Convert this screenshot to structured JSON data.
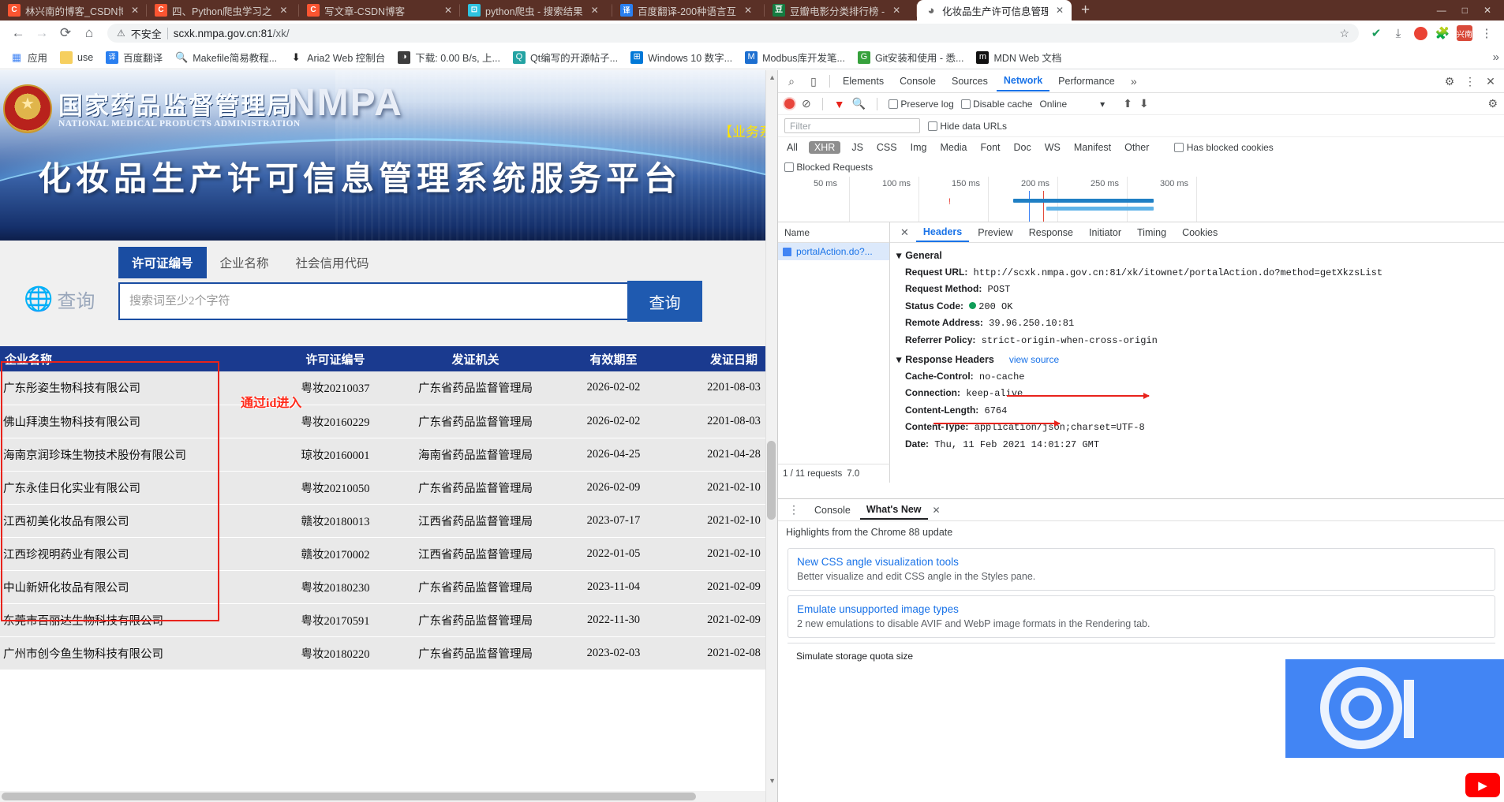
{
  "browser": {
    "tabs": [
      {
        "title": "林兴南的博客_CSDN博客",
        "icon": "csdn-icon",
        "active": false
      },
      {
        "title": "四、Python爬虫学习之",
        "icon": "csdn-icon",
        "active": false
      },
      {
        "title": "写文章-CSDN博客",
        "icon": "csdn-icon",
        "active": false
      },
      {
        "title": "python爬虫 - 搜索结果",
        "icon": "bot-icon",
        "active": false
      },
      {
        "title": "百度翻译-200种语言互",
        "icon": "translate-icon",
        "active": false
      },
      {
        "title": "豆瓣电影分类排行榜 - ",
        "icon": "douban-icon",
        "active": false
      },
      {
        "title": "化妆品生产许可信息管理",
        "icon": "globe-icon",
        "active": true
      }
    ],
    "new_tab_label": "+",
    "window_controls": [
      "—",
      "□",
      "✕"
    ],
    "omnibox": {
      "security_label": "不安全",
      "url_host": "scxk.nmpa.gov.cn:81",
      "url_path": "/xk/",
      "star_icon": "star-icon"
    },
    "toolbar_icons": [
      "back-icon",
      "forward-icon",
      "reload-icon",
      "home-icon",
      "avast-icon",
      "download-icon",
      "record-icon",
      "extensions-icon",
      "profile-icon",
      "menu-icon"
    ],
    "profile_label": "兴南",
    "bookmarks": [
      {
        "label": "应用",
        "icon": "apps-grid-icon"
      },
      {
        "label": "use",
        "icon": "folder-icon"
      },
      {
        "label": "百度翻译",
        "icon": "translate-icon"
      },
      {
        "label": "Makefile简易教程...",
        "icon": "search-page-icon"
      },
      {
        "label": "Aria2 Web 控制台",
        "icon": "download-arrow-icon"
      },
      {
        "label": "下载: 0.00 B/s, 上...",
        "icon": "speedometer-icon"
      },
      {
        "label": "Qt编写的开源帖子...",
        "icon": "qt-icon"
      },
      {
        "label": "Windows 10 数字...",
        "icon": "windows-icon"
      },
      {
        "label": "Modbus库开发笔...",
        "icon": "doc-icon"
      },
      {
        "label": "Git安装和使用 - 悉...",
        "icon": "git-icon"
      },
      {
        "label": "MDN Web 文档",
        "icon": "mdn-icon"
      }
    ],
    "bookmark_overflow": "»"
  },
  "site": {
    "org_cn": "国家药品监督管理局",
    "org_en": "NATIONAL MEDICAL PRODUCTS ADMINISTRATION",
    "brand": "NMPA",
    "system_title": "化妆品生产许可信息管理系统服务平台",
    "biz_link": "【业务系",
    "emblem_icon": "national-emblem-icon",
    "search": {
      "tabs": [
        {
          "label": "许可证编号",
          "active": true
        },
        {
          "label": "企业名称",
          "active": false
        },
        {
          "label": "社会信用代码",
          "active": false
        }
      ],
      "placeholder": "搜索词至少2个字符",
      "value": "",
      "button_label": "查询",
      "side_label": "查询",
      "globe_icon": "globe-search-icon"
    },
    "table": {
      "columns": [
        "企业名称",
        "许可证编号",
        "发证机关",
        "有效期至",
        "发证日期"
      ],
      "rows": [
        [
          "广东彤姿生物科技有限公司",
          "粤妆20210037",
          "广东省药品监督管理局",
          "2026-02-02",
          "2201-08-03"
        ],
        [
          "佛山拜澳生物科技有限公司",
          "粤妆20160229",
          "广东省药品监督管理局",
          "2026-02-02",
          "2201-08-03"
        ],
        [
          "海南京润珍珠生物技术股份有限公司",
          "琼妆20160001",
          "海南省药品监督管理局",
          "2026-04-25",
          "2021-04-28"
        ],
        [
          "广东永佳日化实业有限公司",
          "粤妆20210050",
          "广东省药品监督管理局",
          "2026-02-09",
          "2021-02-10"
        ],
        [
          "江西初美化妆品有限公司",
          "赣妆20180013",
          "江西省药品监督管理局",
          "2023-07-17",
          "2021-02-10"
        ],
        [
          "江西珍视明药业有限公司",
          "赣妆20170002",
          "江西省药品监督管理局",
          "2022-01-05",
          "2021-02-10"
        ],
        [
          "中山新妍化妆品有限公司",
          "粤妆20180230",
          "广东省药品监督管理局",
          "2023-11-04",
          "2021-02-09"
        ],
        [
          "东莞市百丽达生物科技有限公司",
          "粤妆20170591",
          "广东省药品监督管理局",
          "2022-11-30",
          "2021-02-09"
        ],
        [
          "广州市创今鱼生物科技有限公司",
          "粤妆20180220",
          "广东省药品监督管理局",
          "2023-02-03",
          "2021-02-08"
        ]
      ],
      "annotation": "通过id进入"
    }
  },
  "devtools": {
    "panels": [
      {
        "label": "Elements",
        "active": false
      },
      {
        "label": "Console",
        "active": false
      },
      {
        "label": "Sources",
        "active": false
      },
      {
        "label": "Network",
        "active": true
      },
      {
        "label": "Performance",
        "active": false
      }
    ],
    "panel_overflow": "»",
    "settings_icon": "gear-icon",
    "more_icon": "kebab-icon",
    "close_icon": "close-icon",
    "inspect_icon": "inspect-icon",
    "device_icon": "device-toolbar-icon",
    "network": {
      "record_icon": "record-icon",
      "clear_icon": "clear-icon",
      "filter_icon": "filter-funnel-icon",
      "search_icon": "search-icon",
      "preserve_log": "Preserve log",
      "disable_cache": "Disable cache",
      "throttling": "Online",
      "import_icon": "import-har-icon",
      "export_icon": "export-har-icon",
      "filter_placeholder": "Filter",
      "hide_data_urls": "Hide data URLs",
      "types": [
        "All",
        "XHR",
        "JS",
        "CSS",
        "Img",
        "Media",
        "Font",
        "Doc",
        "WS",
        "Manifest",
        "Other"
      ],
      "active_type": "XHR",
      "has_blocked_cookies": "Has blocked cookies",
      "blocked_requests": "Blocked Requests",
      "timeline_ticks": [
        "50 ms",
        "100 ms",
        "150 ms",
        "200 ms",
        "250 ms",
        "300 ms"
      ],
      "name_column": "Name",
      "requests": [
        {
          "name": "portalAction.do?..."
        }
      ],
      "footer_requests": "1 / 11 requests",
      "footer_transferred": "7.0"
    },
    "detail": {
      "tabs": [
        {
          "label": "Headers",
          "active": true
        },
        {
          "label": "Preview",
          "active": false
        },
        {
          "label": "Response",
          "active": false
        },
        {
          "label": "Initiator",
          "active": false
        },
        {
          "label": "Timing",
          "active": false
        },
        {
          "label": "Cookies",
          "active": false
        }
      ],
      "general_title": "General",
      "general": [
        {
          "key": "Request URL:",
          "value": "http://scxk.nmpa.gov.cn:81/xk/itownet/portalAction.do?method=getXkzsList"
        },
        {
          "key": "Request Method:",
          "value": "POST"
        },
        {
          "key": "Status Code:",
          "value": "200 OK",
          "status": true
        },
        {
          "key": "Remote Address:",
          "value": "39.96.250.10:81"
        },
        {
          "key": "Referrer Policy:",
          "value": "strict-origin-when-cross-origin"
        }
      ],
      "response_title": "Response Headers",
      "view_source": "view source",
      "response": [
        {
          "key": "Cache-Control:",
          "value": "no-cache"
        },
        {
          "key": "Connection:",
          "value": "keep-alive"
        },
        {
          "key": "Content-Length:",
          "value": "6764"
        },
        {
          "key": "Content-Type:",
          "value": "application/json;charset=UTF-8"
        },
        {
          "key": "Date:",
          "value": "Thu, 11 Feb 2021 14:01:27 GMT"
        }
      ]
    },
    "drawer": {
      "tabs": [
        {
          "label": "Console",
          "active": false
        },
        {
          "label": "What's New",
          "active": true
        }
      ],
      "close_icon": "close-icon",
      "subhead": "Highlights from the Chrome 88 update",
      "cards": [
        {
          "title": "New CSS angle visualization tools",
          "desc": "Better visualize and edit CSS angle in the Styles pane."
        },
        {
          "title": "Emulate unsupported image types",
          "desc": "2 new emulations to disable AVIF and WebP image formats in the Rendering tab."
        },
        {
          "title": "Simulate storage quota size",
          "desc": ""
        }
      ],
      "play_icon": "play-icon"
    }
  },
  "colors": {
    "chrome_tabstrip": "#5a3026",
    "nmpa_blue": "#1a3a8f",
    "accent_blue": "#1a73e8",
    "annotation_red": "#e8231c",
    "status_green": "#0f9d58"
  }
}
